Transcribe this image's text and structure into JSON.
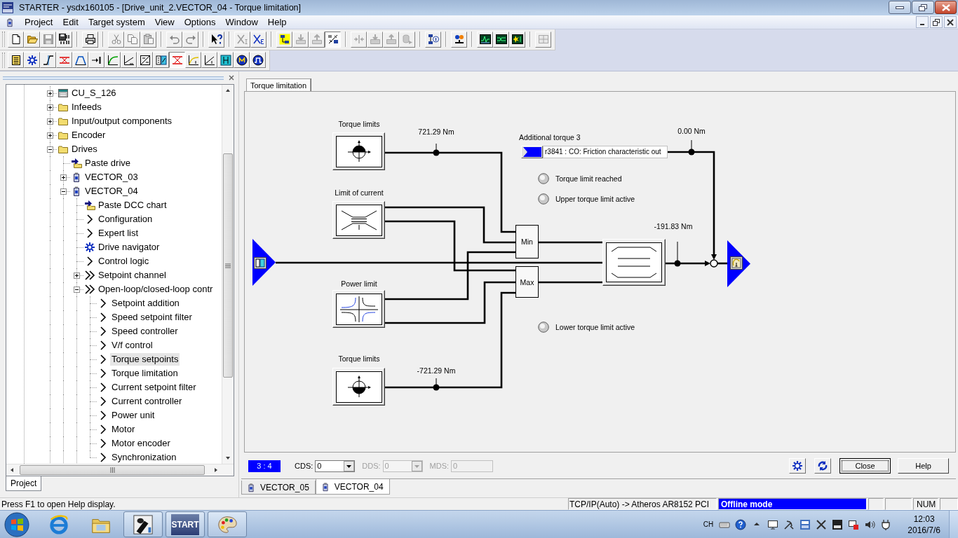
{
  "window": {
    "title": "STARTER - ysdx160105 - [Drive_unit_2.VECTOR_04 - Torque limitation]"
  },
  "menu": [
    "Project",
    "Edit",
    "Target system",
    "View",
    "Options",
    "Window",
    "Help"
  ],
  "toolbars": [
    {
      "groups": [
        {
          "buttons": [
            {
              "kind": "new",
              "disabled": false,
              "pressed": false
            },
            {
              "kind": "open",
              "disabled": false,
              "pressed": false
            },
            {
              "kind": "save",
              "disabled": true,
              "pressed": false
            },
            {
              "kind": "compile",
              "disabled": false,
              "pressed": false
            }
          ]
        },
        {
          "buttons": [
            {
              "kind": "print",
              "disabled": false,
              "pressed": false
            }
          ]
        },
        {
          "buttons": [
            {
              "kind": "cut",
              "disabled": true,
              "pressed": false
            },
            {
              "kind": "copy",
              "disabled": true,
              "pressed": false
            },
            {
              "kind": "paste",
              "disabled": true,
              "pressed": false
            }
          ]
        },
        {
          "buttons": [
            {
              "kind": "undo",
              "disabled": true,
              "pressed": false
            },
            {
              "kind": "redo",
              "disabled": true,
              "pressed": false
            }
          ]
        },
        {
          "buttons": [
            {
              "kind": "help",
              "disabled": false,
              "pressed": false
            }
          ]
        },
        {
          "buttons": [
            {
              "kind": "varin",
              "disabled": true,
              "pressed": false
            },
            {
              "kind": "varext",
              "disabled": false,
              "pressed": false
            }
          ]
        },
        {
          "buttons": [
            {
              "kind": "connect",
              "disabled": false,
              "pressed": false
            },
            {
              "kind": "download",
              "disabled": true,
              "pressed": false
            },
            {
              "kind": "upload",
              "disabled": true,
              "pressed": false
            },
            {
              "kind": "toggle",
              "disabled": false,
              "pressed": true
            }
          ]
        },
        {
          "buttons": [
            {
              "kind": "merge",
              "disabled": true,
              "pressed": false
            },
            {
              "kind": "loaddrive",
              "disabled": true,
              "pressed": false
            },
            {
              "kind": "savedrive",
              "disabled": true,
              "pressed": false
            },
            {
              "kind": "cylinder",
              "disabled": true,
              "pressed": false
            }
          ]
        },
        {
          "buttons": [
            {
              "kind": "deviceinfo",
              "disabled": false,
              "pressed": false
            }
          ]
        },
        {
          "buttons": [
            {
              "kind": "topology",
              "disabled": false,
              "pressed": false
            }
          ]
        },
        {
          "buttons": [
            {
              "kind": "scope",
              "disabled": false,
              "pressed": false
            },
            {
              "kind": "trace",
              "disabled": false,
              "pressed": false
            },
            {
              "kind": "analyzer",
              "disabled": false,
              "pressed": false
            }
          ]
        },
        {
          "buttons": [
            {
              "kind": "table",
              "disabled": true,
              "pressed": false
            }
          ]
        }
      ]
    },
    {
      "groups": [
        {
          "buttons": [
            {
              "kind": "list",
              "disabled": false,
              "pressed": false
            },
            {
              "kind": "navigator",
              "disabled": false,
              "pressed": false
            },
            {
              "kind": "ramp",
              "disabled": false,
              "pressed": false
            },
            {
              "kind": "limits",
              "disabled": false,
              "pressed": false
            },
            {
              "kind": "trapezoid",
              "disabled": false,
              "pressed": false
            },
            {
              "kind": "setpoint",
              "disabled": false,
              "pressed": false
            },
            {
              "kind": "curve",
              "disabled": false,
              "pressed": false
            },
            {
              "kind": "graph",
              "disabled": false,
              "pressed": false
            },
            {
              "kind": "vf",
              "disabled": false,
              "pressed": false
            },
            {
              "kind": "switch",
              "disabled": false,
              "pressed": false
            },
            {
              "kind": "torque",
              "disabled": false,
              "pressed": true
            },
            {
              "kind": "current",
              "disabled": false,
              "pressed": false
            },
            {
              "kind": "chart",
              "disabled": false,
              "pressed": false
            },
            {
              "kind": "inverter",
              "disabled": false,
              "pressed": false
            },
            {
              "kind": "motor",
              "disabled": false,
              "pressed": false
            },
            {
              "kind": "pulse",
              "disabled": false,
              "pressed": false
            }
          ]
        }
      ]
    }
  ],
  "project_tree": {
    "items": [
      {
        "label": "CU_S_126",
        "kind": "cu",
        "expanded": false,
        "selected": false
      },
      {
        "label": "Infeeds",
        "kind": "folder",
        "expanded": false,
        "selected": false
      },
      {
        "label": "Input/output components",
        "kind": "folder",
        "expanded": false,
        "selected": false
      },
      {
        "label": "Encoder",
        "kind": "folder",
        "expanded": false,
        "selected": false
      },
      {
        "label": "Drives",
        "kind": "folder",
        "expanded": true,
        "selected": false,
        "children": [
          {
            "label": "Paste drive",
            "kind": "paste",
            "selected": false
          },
          {
            "label": "VECTOR_03",
            "kind": "drive",
            "expanded": false,
            "selected": false
          },
          {
            "label": "VECTOR_04",
            "kind": "drive",
            "expanded": true,
            "selected": false,
            "children": [
              {
                "label": "Paste DCC chart",
                "kind": "paste",
                "selected": false
              },
              {
                "label": "Configuration",
                "kind": "function",
                "selected": false
              },
              {
                "label": "Expert list",
                "kind": "function",
                "selected": false
              },
              {
                "label": "Drive navigator",
                "kind": "navigator",
                "selected": false
              },
              {
                "label": "Control logic",
                "kind": "function",
                "selected": false
              },
              {
                "label": "Setpoint channel",
                "kind": "group",
                "expanded": false,
                "selected": false
              },
              {
                "label": "Open-loop/closed-loop contr",
                "kind": "group",
                "expanded": true,
                "selected": false,
                "children": [
                  {
                    "label": "Setpoint addition",
                    "kind": "function",
                    "selected": false
                  },
                  {
                    "label": "Speed setpoint filter",
                    "kind": "function",
                    "selected": false
                  },
                  {
                    "label": "Speed controller",
                    "kind": "function",
                    "selected": false
                  },
                  {
                    "label": "V/f control",
                    "kind": "function",
                    "selected": false
                  },
                  {
                    "label": "Torque setpoints",
                    "kind": "function",
                    "selected": true
                  },
                  {
                    "label": "Torque limitation",
                    "kind": "function",
                    "selected": false
                  },
                  {
                    "label": "Current setpoint filter",
                    "kind": "function",
                    "selected": false
                  },
                  {
                    "label": "Current controller",
                    "kind": "function",
                    "selected": false
                  },
                  {
                    "label": "Power unit",
                    "kind": "function",
                    "selected": false
                  },
                  {
                    "label": "Motor",
                    "kind": "function",
                    "selected": false
                  },
                  {
                    "label": "Motor encoder",
                    "kind": "function",
                    "selected": false
                  },
                  {
                    "label": "Synchronization",
                    "kind": "function",
                    "selected": false
                  }
                ]
              }
            ]
          }
        ]
      }
    ],
    "tab": "Project"
  },
  "document": {
    "tab": "Torque limitation",
    "diagram": {
      "blocks": [
        {
          "label": "Torque limits",
          "kind": "uppertorque",
          "value": "721.29 Nm"
        },
        {
          "label": "Limit of current",
          "kind": "current"
        },
        {
          "label": "Power limit",
          "kind": "power"
        },
        {
          "label": "Torque limits",
          "kind": "lowertorque",
          "value": "-721.29 Nm"
        }
      ],
      "min": "Min",
      "max": "Max",
      "limiter_value": "-191.83 Nm",
      "additional_torque": {
        "label": "Additional torque 3",
        "source": "r3841 : CO: Friction characteristic out",
        "value": "0.00 Nm"
      },
      "indicators": [
        {
          "label": "Torque limit reached",
          "on": false
        },
        {
          "label": "Upper torque limit active",
          "on": false
        },
        {
          "label": "Lower torque limit active",
          "on": false
        }
      ]
    },
    "dataset": {
      "index": "3 : 4",
      "fields": [
        {
          "label": "CDS:",
          "value": "0",
          "kind": "dropdown",
          "disabled": false
        },
        {
          "label": "DDS:",
          "value": "0",
          "kind": "dropdown",
          "disabled": true
        },
        {
          "label": "MDS:",
          "value": "0",
          "kind": "field",
          "disabled": true
        }
      ]
    },
    "buttons": [
      {
        "label": "Close",
        "focused": true
      },
      {
        "label": "Help",
        "focused": false
      }
    ]
  },
  "document_tabs": [
    {
      "label": "VECTOR_05",
      "selected": false
    },
    {
      "label": "VECTOR_04",
      "selected": true
    }
  ],
  "status_bar": {
    "message": "Press F1 to open Help display.",
    "connection": "TCP/IP(Auto) -> Atheros AR8152 PCI",
    "mode": "Offline mode",
    "keys": "NUM"
  },
  "taskbar": {
    "apps": [
      {
        "kind": "browser",
        "running": false
      },
      {
        "kind": "explorer",
        "running": false
      },
      {
        "kind": "tool",
        "running": true
      },
      {
        "kind": "starter",
        "label": "START",
        "running": true
      },
      {
        "kind": "paint",
        "running": true
      }
    ],
    "language": "CH",
    "time": "12:03",
    "date": "2016/7/6"
  }
}
